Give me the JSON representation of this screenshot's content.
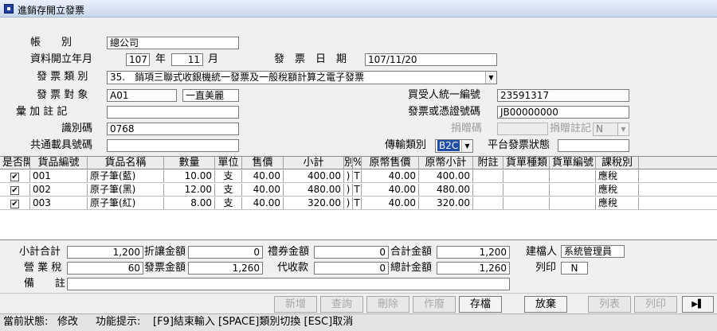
{
  "window": {
    "title": "進銷存開立發票"
  },
  "header": {
    "account_label": "帳　　別",
    "account_value": "總公司",
    "period_label": "資料開立年月",
    "year_value": "107",
    "year_unit": "年",
    "month_value": "11",
    "month_unit": "月",
    "invoice_date_label": "發　票　日　期",
    "invoice_date_value": "107/11/20",
    "invoice_type_label": "發 票 類 別",
    "invoice_type_value": "35.　銷項三聯式收銀機統一發票及一般稅額計算之電子發票",
    "customer_label": "發 票 對 象",
    "customer_code": "A01",
    "customer_name": "一直美麗",
    "buyer_tax_label": "買受人統一編號",
    "buyer_tax_value": "23591317",
    "extra_note_label": "彙 加 註 記",
    "extra_note_value": "",
    "invoice_no_label": "發票或憑證號碼",
    "invoice_no_value": "JB00000000",
    "id_code_label": "識別碼",
    "id_code_value": "0768",
    "donation_code_label": "捐贈碼",
    "donation_code_value": "",
    "donation_mark_label": "捐贈註記",
    "donation_mark_value": "N",
    "carrier_label": "共通載具號碼",
    "carrier_value": "",
    "transmit_label": "傳輸類別",
    "transmit_value": "B2C",
    "platform_label": "平台發票狀態",
    "platform_value": ""
  },
  "grid": {
    "columns": [
      "是否開",
      "貨品編號",
      "貨品名稱",
      "數量",
      "單位",
      "售價",
      "小計",
      "別",
      "%",
      "原幣售價",
      "原幣小計",
      "附註",
      "貨單種類",
      "貨單編號",
      "課稅別"
    ],
    "rows": [
      {
        "checked": "✔",
        "code": "001",
        "name": "原子筆(藍)",
        "qty": "10.00",
        "unit": "支",
        "price": "40.00",
        "subtotal": "400.00",
        "cur": ")",
        "pct": "T",
        "orig_price": "40.00",
        "orig_subtotal": "400.00",
        "note": "",
        "doc_type": "",
        "doc_no": "",
        "tax": "應稅"
      },
      {
        "checked": "✔",
        "code": "002",
        "name": "原子筆(黑)",
        "qty": "12.00",
        "unit": "支",
        "price": "40.00",
        "subtotal": "480.00",
        "cur": ")",
        "pct": "T",
        "orig_price": "40.00",
        "orig_subtotal": "480.00",
        "note": "",
        "doc_type": "",
        "doc_no": "",
        "tax": "應稅"
      },
      {
        "checked": "✔",
        "code": "003",
        "name": "原子筆(紅)",
        "qty": "8.00",
        "unit": "支",
        "price": "40.00",
        "subtotal": "320.00",
        "cur": ")",
        "pct": "T",
        "orig_price": "40.00",
        "orig_subtotal": "320.00",
        "note": "",
        "doc_type": "",
        "doc_no": "",
        "tax": "應稅"
      }
    ]
  },
  "totals": {
    "subtotal_label": "小計合計",
    "subtotal_value": "1,200",
    "discount_label": "折讓金額",
    "discount_value": "0",
    "voucher_label": "禮券金額",
    "voucher_value": "0",
    "total_label": "合計金額",
    "total_value": "1,200",
    "creator_label": "建檔人",
    "creator_value": "系統管理員",
    "tax_label": "營 業 稅",
    "tax_value": "60",
    "invoice_amount_label": "發票金額",
    "invoice_amount_value": "1,260",
    "collect_label": "代收款",
    "collect_value": "0",
    "grand_total_label": "總計金額",
    "grand_total_value": "1,260",
    "print_label": "列印",
    "print_value": "N",
    "remark_label": "備　　註",
    "remark_value": ""
  },
  "toolbar": {
    "add": "新增",
    "query": "查詢",
    "delete": "刪除",
    "void": "作廢",
    "save": "存檔",
    "discard": "放棄",
    "list": "列表",
    "print": "列印",
    "next_icon": "next-icon"
  },
  "status": {
    "state_label": "當前狀態:",
    "state_value": "修改",
    "hint_label": "功能提示:",
    "hint_value": "[F9]結束輸入 [SPACE]類別切換 [ESC]取消"
  }
}
